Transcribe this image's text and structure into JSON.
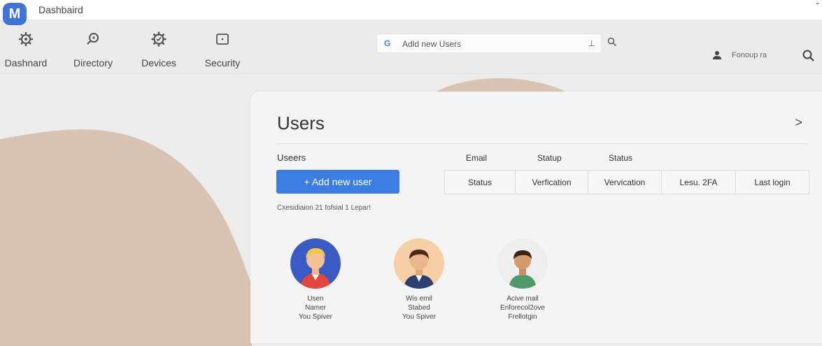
{
  "app": {
    "logo_letter": "M",
    "title": "Dashbaird"
  },
  "nav": [
    {
      "label": "Dashnard",
      "icon": "gear-icon"
    },
    {
      "label": "Directory",
      "icon": "search-icon"
    },
    {
      "label": "Devices",
      "icon": "settings-gear-icon"
    },
    {
      "label": "Security",
      "icon": "square-dot-icon"
    }
  ],
  "search": {
    "value": "Adld new Users",
    "icon": "G"
  },
  "user": {
    "name": "Fonoup ra"
  },
  "colors": {
    "primary": "#3b7de0",
    "logo": "#3f73d8",
    "background_wave": "#d9c4b3"
  },
  "users_panel": {
    "title": "Users",
    "section_label": "Useers",
    "column_headers": [
      "Email",
      "Statup",
      "Status"
    ],
    "add_button": "+ Add new user",
    "filter_tabs": [
      "Status",
      "Verfication",
      "Vervication",
      "Lesu. 2FA",
      "Last login"
    ],
    "summary": "Cxesidiaion 21 fofsial 1 Lepar!",
    "users": [
      {
        "lines": [
          "Usen",
          "Namer",
          "You Spiver"
        ]
      },
      {
        "lines": [
          "Wis emil",
          "Stabed",
          "You Spiver"
        ]
      },
      {
        "lines": [
          "Acive mail",
          "Enforecol2ove",
          "Frellotgin"
        ]
      }
    ]
  }
}
